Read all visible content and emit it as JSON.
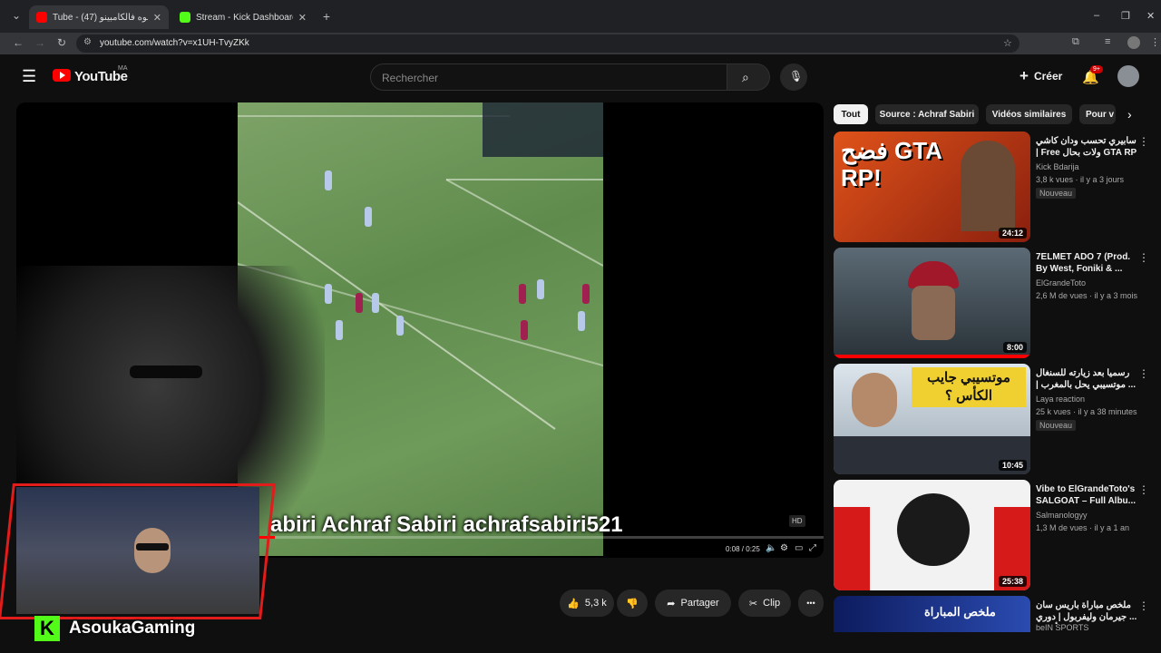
{
  "browser": {
    "tabs": [
      {
        "label": "Tube - طلقوه فالكامبينو (47)",
        "active": true,
        "color": "#ff0000"
      },
      {
        "label": "Stream - Kick Dashboard",
        "active": false,
        "color": "#53fc18"
      }
    ],
    "new_tab": "+",
    "url": "youtube.com/watch?v=x1UH-TvyZKk",
    "win_min": "–",
    "win_max": "❐",
    "win_close": "✕"
  },
  "youtube": {
    "logo_text": "YouTube",
    "region": "MA",
    "search_placeholder": "Rechercher",
    "create_label": "Créer",
    "notif_count": "9+"
  },
  "video": {
    "overlay_text": "abiri  Achraf Sabiri  achrafsabiri521",
    "time": "0:08 / 0:25",
    "hd_badge": "HD"
  },
  "streamer": {
    "name": "AsoukaGaming",
    "platform_letter": "K"
  },
  "actions": {
    "likes": "5,3 k",
    "share": "Partager",
    "clip": "Clip",
    "more": "•••"
  },
  "sidebar": {
    "chips": [
      "Tout",
      "Source : Achraf Sabiri",
      "Vidéos similaires",
      "Pour v"
    ],
    "videos": [
      {
        "title": "سابيري تحسب ودان كاشي | Free ولات بحال GTA RP ...",
        "channel": "Kick Bdarija",
        "meta": "3,8 k vues · il y a 3 jours",
        "badge": "Nouveau",
        "duration": "24:12",
        "thumb_text": "فضح GTA RP!",
        "thumb_color": "#d44a12"
      },
      {
        "title": "7ELMET ADO 7 (Prod. By West, Foniki & ...",
        "channel": "ElGrandeToto",
        "meta": "2,6 M de vues · il y a 3 mois",
        "badge": "",
        "duration": "8:00",
        "thumb_text": "",
        "thumb_color": "#3b4750"
      },
      {
        "title": "رسميا بعد زيارته للسنغال ... موتسيبي يحل بالمغرب | و",
        "channel": "Laya reaction",
        "meta": "25 k vues · il y a 38 minutes",
        "badge": "Nouveau",
        "duration": "10:45",
        "thumb_text": "موتسيبي جايب الكأس ؟",
        "thumb_color": "#c9d6e0"
      },
      {
        "title": "Vibe to ElGrandeToto's SALGOAT – Full Albu...",
        "channel": "Salmanologyy",
        "meta": "1,3 M de vues · il y a 1 an",
        "badge": "",
        "duration": "25:38",
        "thumb_text": "",
        "thumb_color": "#e8e8e8"
      },
      {
        "title": "ملخص مباراة باريس سان ... جيرمان وليفربول | دوري أبطال",
        "channel": "beIN SPORTS",
        "meta": "",
        "badge": "",
        "duration": "",
        "thumb_text": "ملخص المباراة",
        "thumb_color": "#1a2a6c"
      }
    ]
  }
}
